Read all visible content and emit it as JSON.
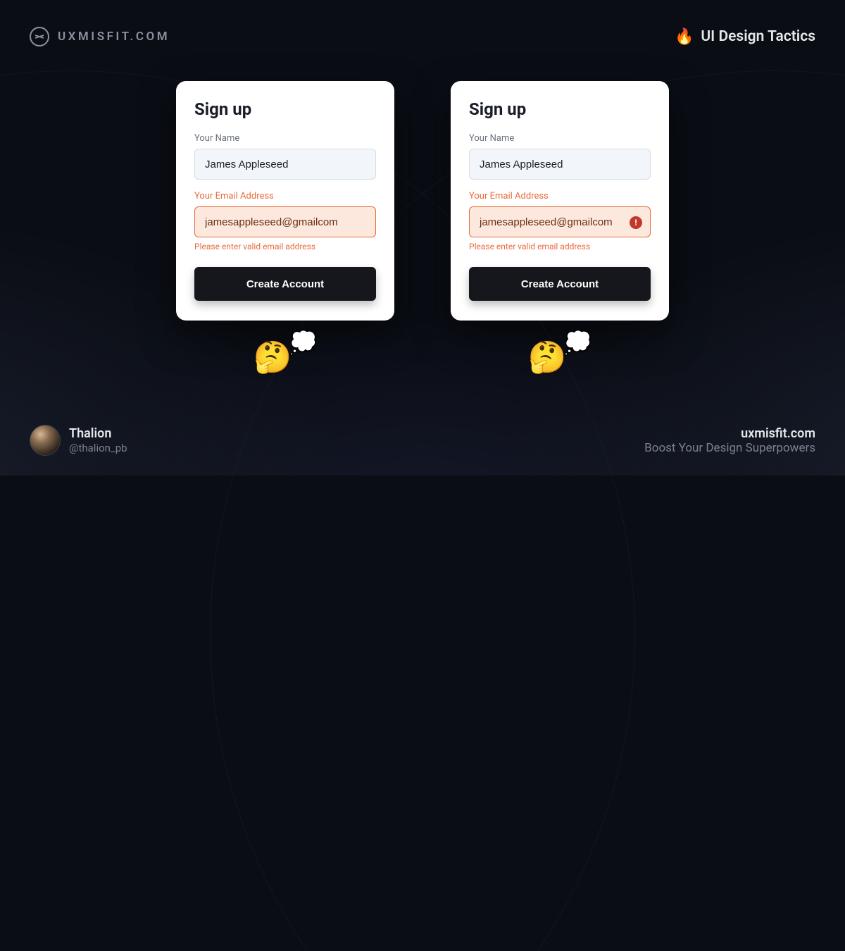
{
  "header": {
    "brand": "UXMISFIT.COM",
    "right_label": "UI Design Tactics",
    "fire_emoji": "🔥"
  },
  "cards": [
    {
      "title": "Sign up",
      "name_label": "Your Name",
      "name_value": "James Appleseed",
      "email_label": "Your Email Address",
      "email_value": "jamesappleseed@gmailcom",
      "error_message": "Please enter valid email address",
      "button_label": "Create Account",
      "show_error_icon": false,
      "thinking_emoji": "🤔",
      "bubble_emoji": "💭"
    },
    {
      "title": "Sign up",
      "name_label": "Your Name",
      "name_value": "James Appleseed",
      "email_label": "Your Email Address",
      "email_value": "jamesappleseed@gmailcom",
      "error_message": "Please enter valid email address",
      "button_label": "Create Account",
      "show_error_icon": true,
      "thinking_emoji": "🤔",
      "bubble_emoji": "💭"
    }
  ],
  "footer": {
    "author_name": "Thalion",
    "author_handle": "@thalion_pb",
    "site": "uxmisfit.com",
    "tagline": "Boost Your Design Superpowers"
  },
  "colors": {
    "error": "#e86b3a",
    "error_bg": "#fce8dd",
    "button_bg": "#15171c",
    "card_bg": "#ffffff",
    "page_bg": "#0a0d14"
  }
}
